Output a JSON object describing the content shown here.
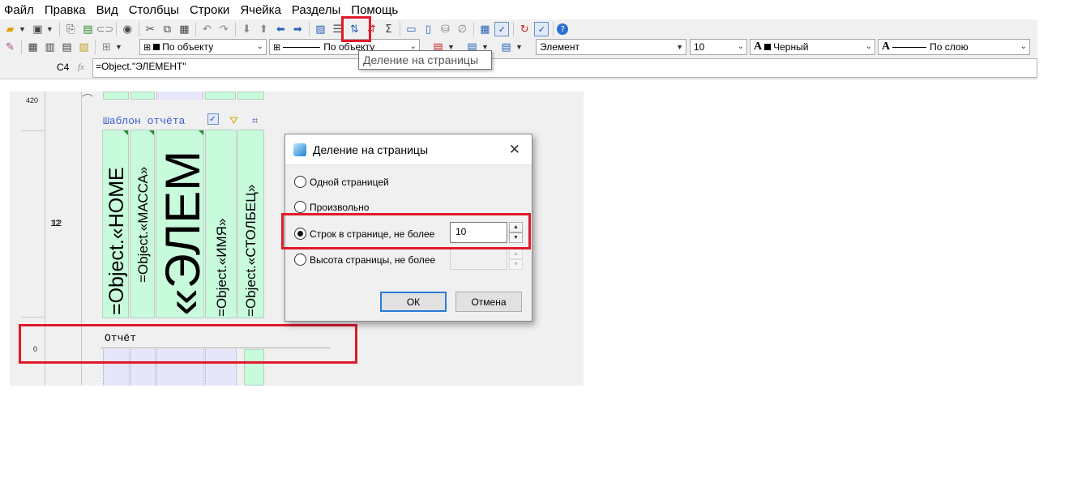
{
  "menu": [
    "Файл",
    "Правка",
    "Вид",
    "Столбцы",
    "Строки",
    "Ячейка",
    "Разделы",
    "Помощь"
  ],
  "toolbar": {
    "border_style_value": "По объекту",
    "line_style_value": "По объекту",
    "style_value": "Элемент",
    "font_size_value": "10",
    "color_value": "Черный",
    "text_style_value": "По слою"
  },
  "tooltip": "Деление на страницы",
  "formula": {
    "cell_ref": "C4",
    "fx_label": "fx",
    "value": "=Object.\"ЭЛЕМЕНТ\""
  },
  "ruler": {
    "labels": [
      "420",
      "12",
      "0"
    ]
  },
  "report": {
    "template_label": "Шаблон отчёта",
    "report_label": "Отчёт",
    "columns": [
      "=Object.«НОМЕ",
      "=Object.«МАССА»",
      "t.«ЭЛЕМ",
      "=Object.«ИМЯ»",
      "=Object.«СТОЛБЕЦ»"
    ]
  },
  "dialog": {
    "title": "Деление на страницы",
    "options": [
      "Одной страницей",
      "Произвольно",
      "Строк в странице, не более",
      "Высота страницы, не более"
    ],
    "selected_index": 2,
    "rows_value": "10",
    "height_value": "",
    "ok_label": "ОК",
    "cancel_label": "Отмена"
  },
  "colors": {
    "highlight_red": "#e01a2a",
    "cell_green": "#c8fadc",
    "cell_lavender": "#e6e6fa",
    "label_blue": "#3b5fd6"
  }
}
